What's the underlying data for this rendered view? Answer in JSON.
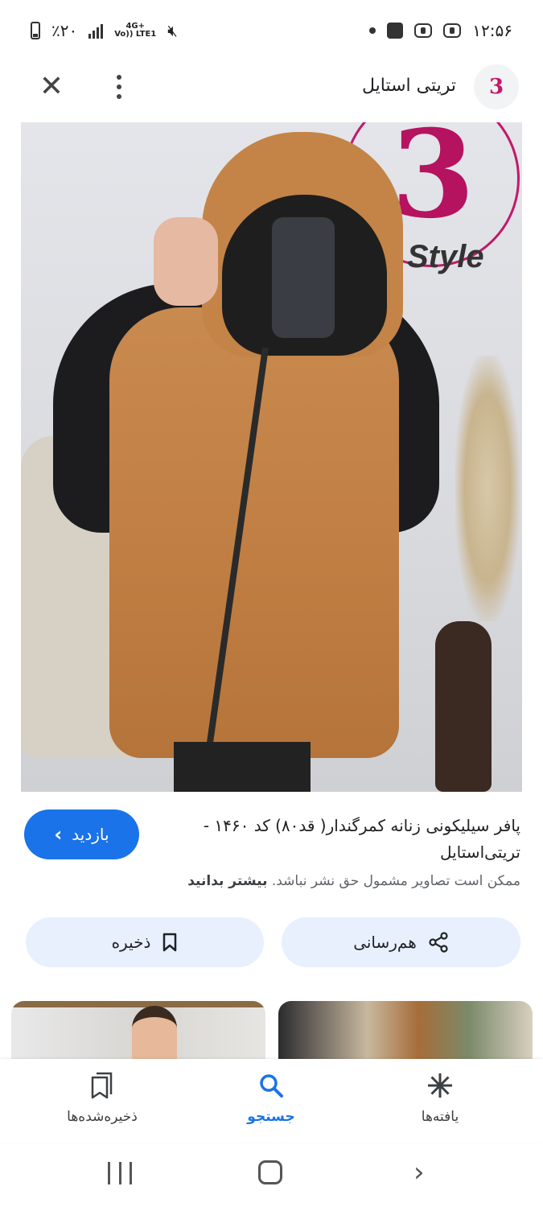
{
  "status_bar": {
    "time": "۱۲:۵۶",
    "battery_percent": "٪۲۰",
    "network_top": "4G+",
    "network_bottom": "Vo)) LTE1"
  },
  "header": {
    "site_name": "تریتی استایل",
    "logo_text": "3",
    "close_icon": "close-icon",
    "more_icon": "more-vert-icon"
  },
  "image": {
    "brand_text": "Style",
    "brand_number": "3",
    "description_icon": "product-photo"
  },
  "result": {
    "title": "پافر سیلیکونی زنانه کمرگندار( قد۸۰) کد ۱۴۶۰ - تریتی‌استایل",
    "visit_label": "بازدید",
    "visit_chevron": "‹",
    "copyright_text": "ممکن است تصاویر مشمول حق نشر نباشد.",
    "learn_more": "بیشتر بدانید"
  },
  "actions": {
    "share_label": "هم‌رسانی",
    "save_label": "ذخیره"
  },
  "bottom_nav": {
    "discover_label": "یافته‌ها",
    "search_label": "جستجو",
    "saved_label": "ذخیره‌شده‌ها",
    "active": "search"
  },
  "colors": {
    "accent": "#1a73e8",
    "pill_bg": "#e8f0fe",
    "brand_magenta": "#c2186b"
  }
}
